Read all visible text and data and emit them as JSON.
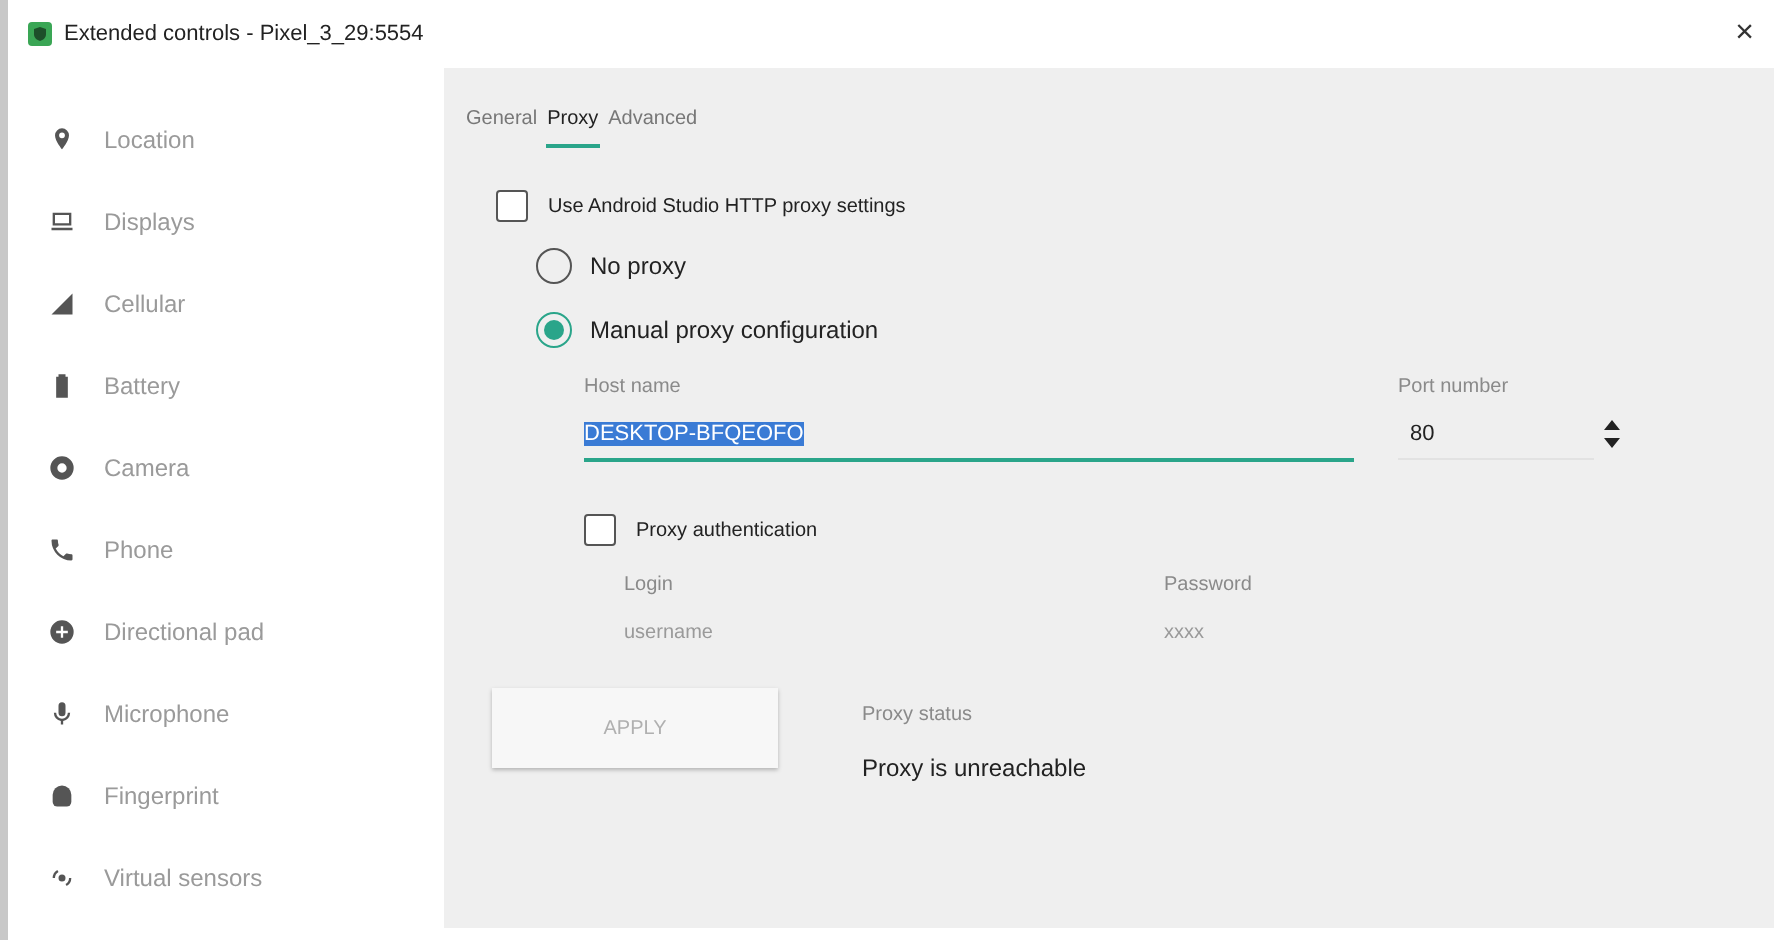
{
  "window": {
    "title": "Extended controls - Pixel_3_29:5554",
    "close": "×"
  },
  "sidebar": {
    "items": [
      {
        "label": "Location",
        "selected": false
      },
      {
        "label": "Displays",
        "selected": false
      },
      {
        "label": "Cellular",
        "selected": false
      },
      {
        "label": "Battery",
        "selected": false
      },
      {
        "label": "Camera",
        "selected": false
      },
      {
        "label": "Phone",
        "selected": false
      },
      {
        "label": "Directional pad",
        "selected": false
      },
      {
        "label": "Microphone",
        "selected": false
      },
      {
        "label": "Fingerprint",
        "selected": false
      },
      {
        "label": "Virtual sensors",
        "selected": false
      }
    ]
  },
  "tabs": [
    {
      "label": "General",
      "selected": false
    },
    {
      "label": "Proxy",
      "selected": true
    },
    {
      "label": "Advanced",
      "selected": false
    }
  ],
  "proxy": {
    "use_studio": {
      "label": "Use Android Studio HTTP proxy settings",
      "checked": false
    },
    "modes": [
      {
        "label": "No proxy",
        "selected": false
      },
      {
        "label": "Manual proxy configuration",
        "selected": true
      }
    ],
    "host": {
      "label": "Host name",
      "value": "DESKTOP-BFQEOFO",
      "text_selected": true
    },
    "port": {
      "label": "Port number",
      "value": "80"
    },
    "auth": {
      "label": "Proxy authentication",
      "checked": false
    },
    "login": {
      "label": "Login",
      "placeholder": "username"
    },
    "password": {
      "label": "Password",
      "placeholder": "xxxx"
    },
    "apply": {
      "label": "APPLY",
      "disabled": true
    },
    "status": {
      "label": "Proxy status",
      "value": "Proxy is unreachable"
    }
  }
}
